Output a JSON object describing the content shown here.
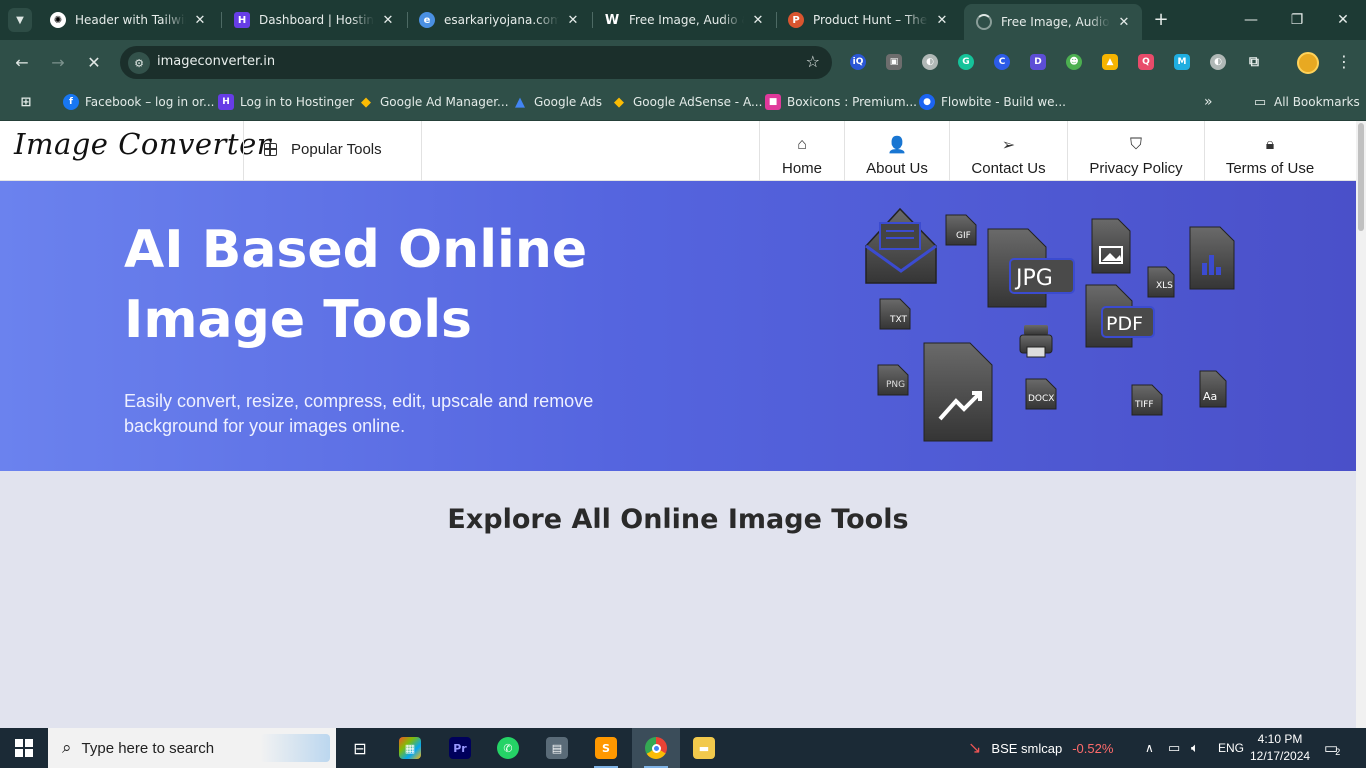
{
  "tabs": [
    {
      "title": "Header with Tailwind",
      "favicon": "openai-icon",
      "color": "#ffffff"
    },
    {
      "title": "Dashboard | Hostinger",
      "favicon": "hostinger-icon",
      "color": "#673de6"
    },
    {
      "title": "esarkariyojana.com -",
      "favicon": "globe-icon",
      "color": "#4a90e2"
    },
    {
      "title": "Free Image, Audio &",
      "favicon": "w-icon",
      "color": "#111111"
    },
    {
      "title": "Product Hunt – The b",
      "favicon": "producthunt-icon",
      "color": "#da552f"
    },
    {
      "title": "Free Image, Audio &",
      "favicon": "loading-icon",
      "color": "#888888"
    }
  ],
  "omnibox": {
    "url": "imageconverter.in"
  },
  "bookmarks": [
    {
      "label": "Facebook – log in or...",
      "color": "#1877f2",
      "glyph": "f"
    },
    {
      "label": "Log in to Hostinger",
      "color": "#673de6",
      "glyph": "H"
    },
    {
      "label": "Google Ad Manager...",
      "color": "#fbbc04",
      "glyph": "◆"
    },
    {
      "label": "Google Ads",
      "color": "#4285f4",
      "glyph": "▲"
    },
    {
      "label": "Google AdSense - A...",
      "color": "#fbbc04",
      "glyph": "◆"
    },
    {
      "label": "Boxicons : Premium...",
      "color": "#e0399b",
      "glyph": "■"
    },
    {
      "label": "Flowbite - Build we...",
      "color": "#1c64f2",
      "glyph": "●"
    }
  ],
  "all_bookmarks": "All Bookmarks",
  "site": {
    "logo": "Image Converter",
    "popular_tools": "Popular Tools",
    "nav": [
      "Home",
      "About Us",
      "Contact Us",
      "Privacy Policy",
      "Terms of Use"
    ],
    "hero_title_line1": "AI Based Online",
    "hero_title_line2": "Image Tools",
    "hero_subtitle": "Easily convert, resize, compress, edit, upscale and remove background for your images online.",
    "file_labels": [
      "GIF",
      "JPG",
      "XLS",
      "TXT",
      "PDF",
      "PNG",
      "DOCX",
      "TIFF",
      "Aa"
    ],
    "explore_heading": "Explore All Online Image Tools"
  },
  "taskbar": {
    "search_placeholder": "Type here to search",
    "stock_name": "BSE smlcap",
    "stock_change": "-0.52%",
    "language": "ENG",
    "time": "4:10 PM",
    "date": "12/17/2024",
    "notification_count": "2"
  },
  "colors": {
    "accent_negative": "#ff6b6b",
    "hero_start": "#6b82ee",
    "hero_end": "#4a50c9"
  }
}
